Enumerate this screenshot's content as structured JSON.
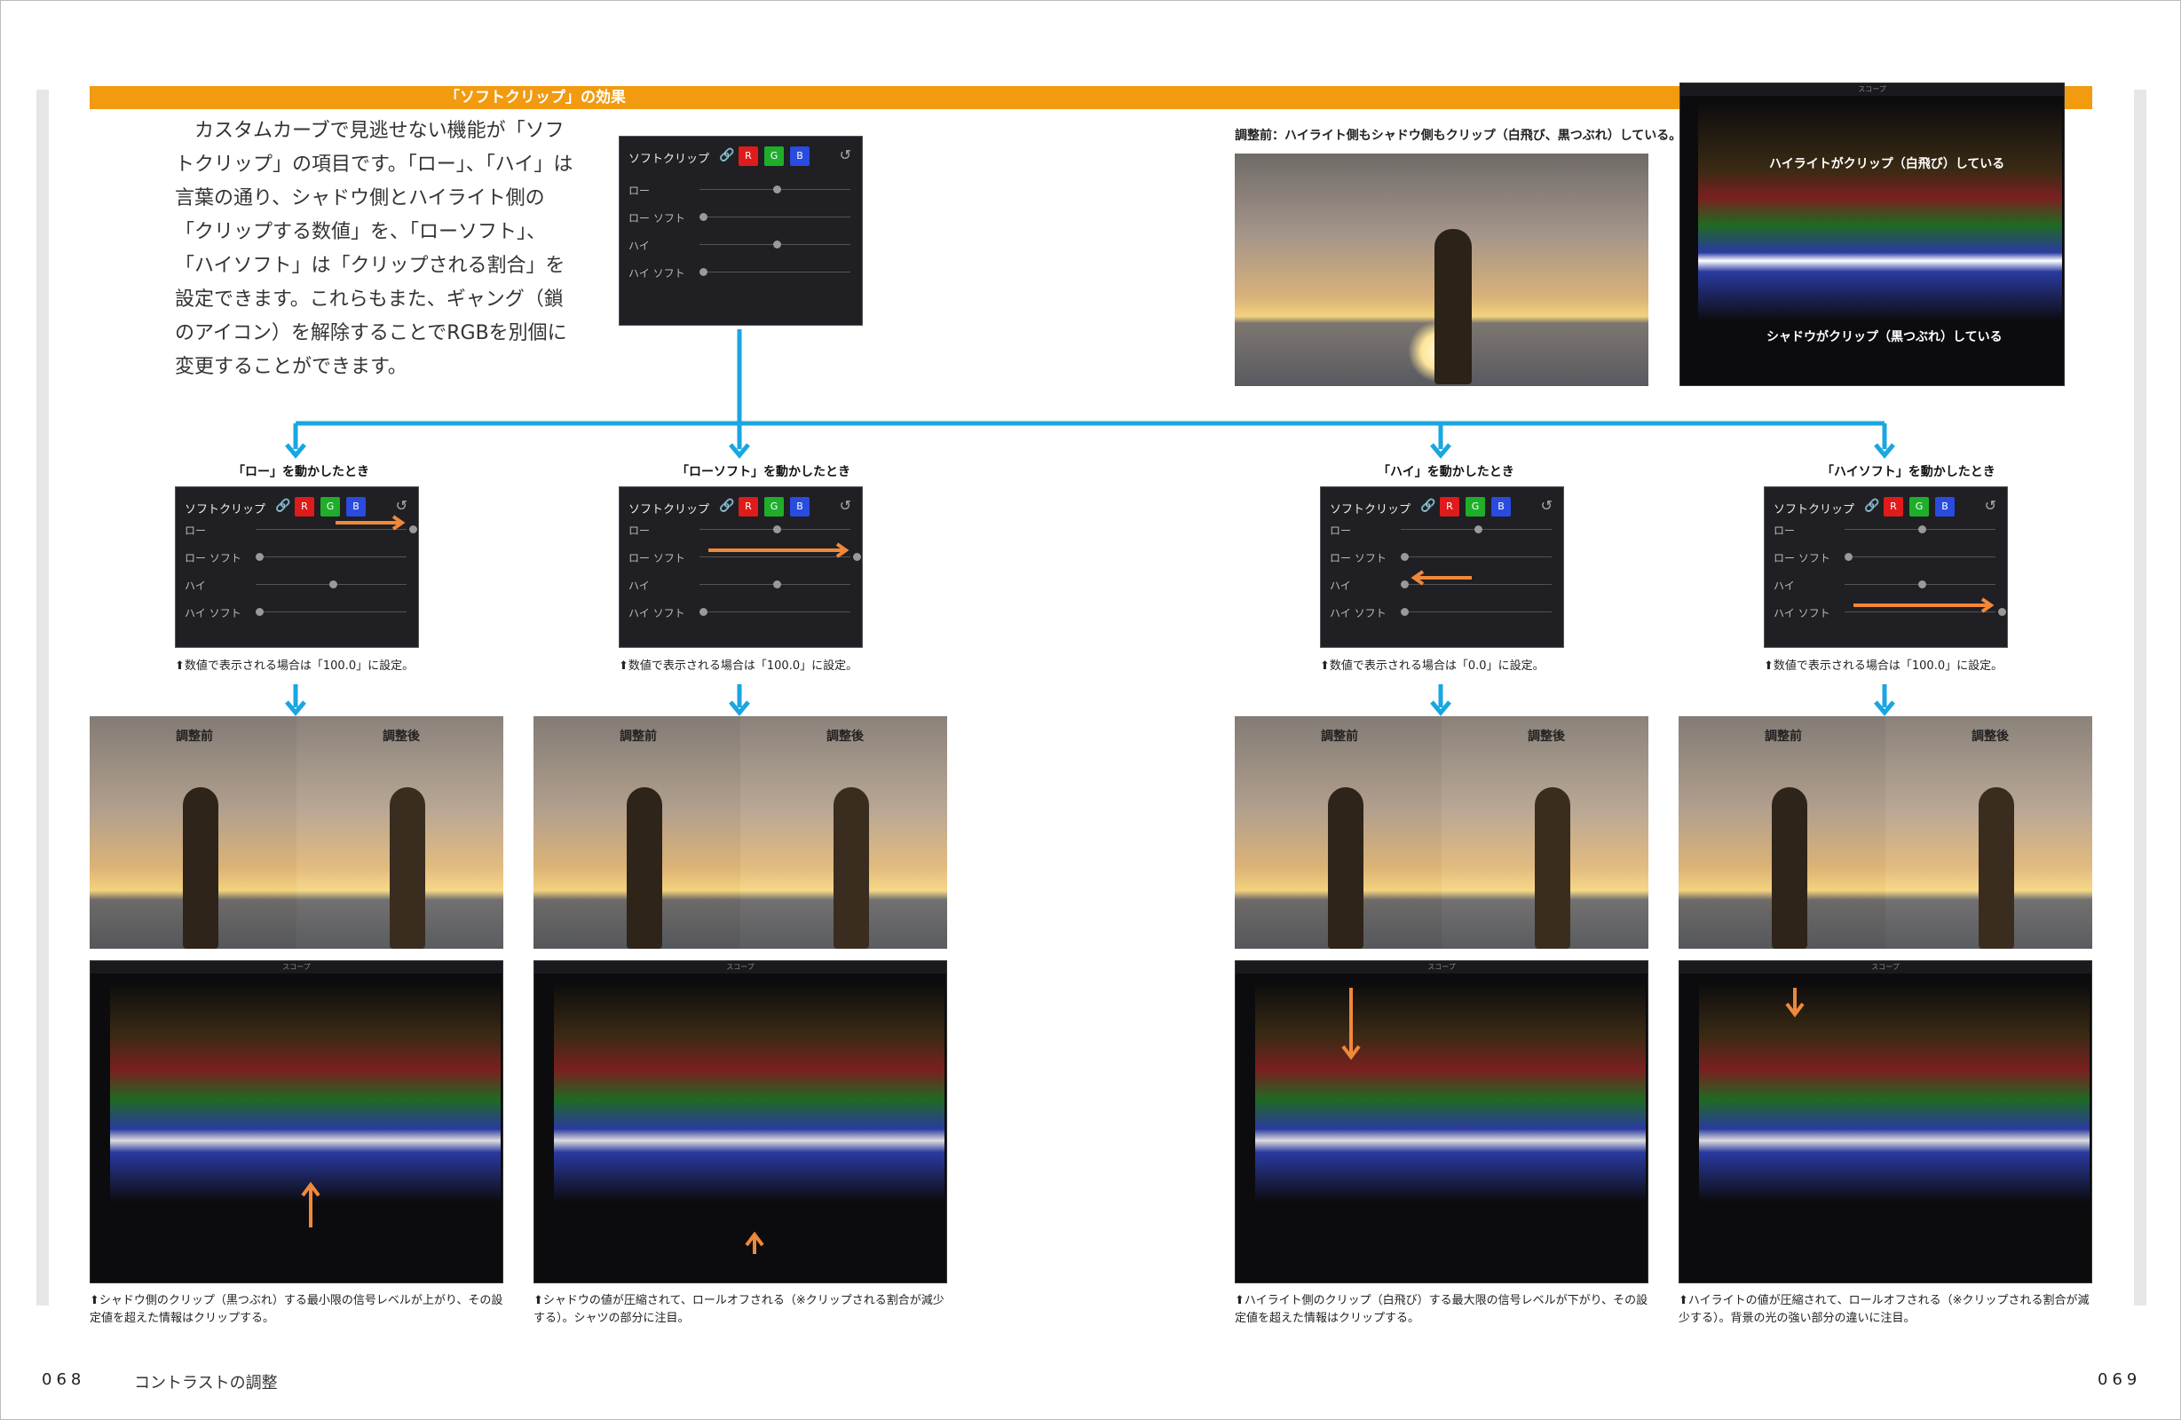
{
  "banner": {
    "title": "「ソフトクリップ」の効果"
  },
  "intro": {
    "text": "カスタムカーブで見逃せない機能が「ソフトクリップ」の項目です。「ロー」、「ハイ」は言葉の通り、シャドウ側とハイライト側の「クリップする数値」を、「ローソフト」、「ハイソフト」は「クリップされる割合」を設定できます。これらもまた、ギャング（鎖のアイコン）を解除することでRGBを別個に変更することができます。"
  },
  "panel": {
    "title": "ソフトクリップ",
    "r": "R",
    "g": "G",
    "b": "B",
    "rows": [
      "ロー",
      "ロー ソフト",
      "ハイ",
      "ハイ ソフト"
    ],
    "colors": {
      "r": "#e01b1b",
      "g": "#1fae2a",
      "b": "#2a4be0"
    }
  },
  "before": {
    "caption": "調整前：ハイライト側もシャドウ側もクリップ（白飛び、黒つぶれ）している。",
    "scope_high": "ハイライトがクリップ（白飛び）している",
    "scope_low": "シャドウがクリップ（黒つぶれ）している"
  },
  "scope": {
    "title": "スコープ"
  },
  "photo_labels": {
    "before": "調整前",
    "after": "調整後"
  },
  "columns": [
    {
      "heading": "「ロー」を動かしたとき",
      "note": "⬆数値で表示される場合は「100.0」に設定。",
      "caption": "⬆シャドウ側のクリップ（黒つぶれ）する最小限の信号レベルが上がり、その設定値を超えた情報はクリップする。"
    },
    {
      "heading": "「ローソフト」を動かしたとき",
      "note": "⬆数値で表示される場合は「100.0」に設定。",
      "caption": "⬆シャドウの値が圧縮されて、ロールオフされる（※クリップされる割合が減少する）。シャツの部分に注目。"
    },
    {
      "heading": "「ハイ」を動かしたとき",
      "note": "⬆数値で表示される場合は「0.0」に設定。",
      "caption": "⬆ハイライト側のクリップ（白飛び）する最大限の信号レベルが下がり、その設定値を超えた情報はクリップする。"
    },
    {
      "heading": "「ハイソフト」を動かしたとき",
      "note": "⬆数値で表示される場合は「100.0」に設定。",
      "caption": "⬆ハイライトの値が圧縮されて、ロールオフされる（※クリップされる割合が減少する）。背景の光の強い部分の違いに注目。"
    }
  ],
  "footer": {
    "left_folio": "068",
    "title": "コントラストの調整",
    "right_folio": "069"
  },
  "accent": {
    "orange": "#f29a10",
    "arrow_orange": "#f0883a",
    "connector": "#1aa6e0"
  }
}
